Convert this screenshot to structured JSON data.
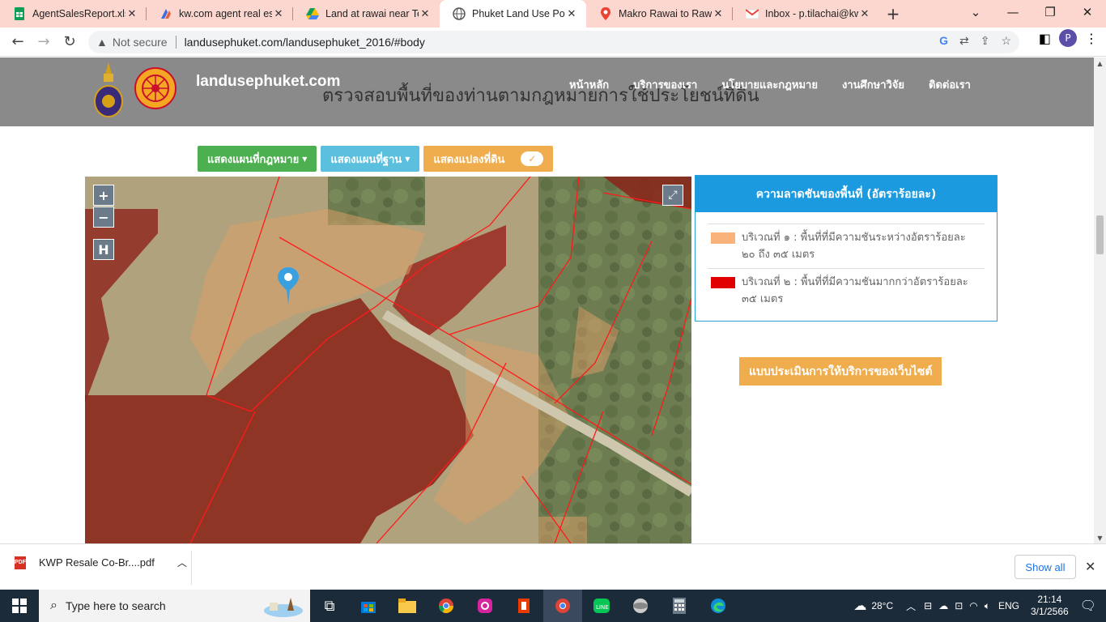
{
  "browser": {
    "tabs": [
      {
        "label": "AgentSalesReport.xlsx",
        "icon": "sheets-icon",
        "active": false
      },
      {
        "label": "kw.com agent real esta",
        "icon": "kw-icon",
        "active": false
      },
      {
        "label": "Land at rawai near Tem",
        "icon": "drive-icon",
        "active": false
      },
      {
        "label": "Phuket Land Use Polic",
        "icon": "globe-icon",
        "active": true
      },
      {
        "label": "Makro Rawai to Rawai",
        "icon": "maps-icon",
        "active": false
      },
      {
        "label": "Inbox - p.tilachai@kw",
        "icon": "gmail-icon",
        "active": false
      }
    ],
    "new_tab": "+",
    "window": {
      "minimize": "—",
      "restore": "❐",
      "close": "✕",
      "tab_search": "⌄"
    },
    "address": {
      "security": "Not secure",
      "url": "landusephuket.com/landusephuket_2016/#body"
    },
    "profile_initial": "P"
  },
  "site": {
    "brand": "landusephuket.com",
    "subtitle": "ตรวจสอบพื้นที่ของท่านตามกฎหมายการใช้ประโยชน์ที่ดิน",
    "nav": [
      "หน้าหลัก",
      "บริการของเรา",
      "นโยบายและกฎหมาย",
      "งานศึกษาวิจัย",
      "ติดต่อเรา"
    ],
    "buttons": {
      "law_map": "แสดงแผนที่กฎหมาย",
      "base_map": "แสดงแผนที่ฐาน",
      "parcels": "แสดงแปลงที่ดิน",
      "parcels_toggle": "✓"
    },
    "map_controls": {
      "zoom_in": "+",
      "zoom_out": "−",
      "home": "H",
      "fullscreen": "⤢"
    },
    "legend": {
      "title": "ความลาดชันของพื้นที่ (อัตราร้อยละ)",
      "items": [
        {
          "text": "บริเวณที่ ๑ : พื้นที่ที่มีความชันระหว่างอัตราร้อยละ ๒๐ ถึง ๓๕ เมตร",
          "color": "#f8b27a"
        },
        {
          "text": "บริเวณที่ ๒ : พื้นที่ที่มีความชันมากกว่าอัตราร้อยละ ๓๕ เมตร",
          "color": "#e00000"
        }
      ]
    },
    "survey_button": "แบบประเมินการให้บริการของเว็บไซต์"
  },
  "downloads": {
    "file": "KWP Resale Co-Br....pdf",
    "show_all": "Show all"
  },
  "taskbar": {
    "search_placeholder": "Type here to search",
    "weather": "28°C",
    "language": "ENG",
    "time": "21:14",
    "date": "3/1/2566"
  }
}
